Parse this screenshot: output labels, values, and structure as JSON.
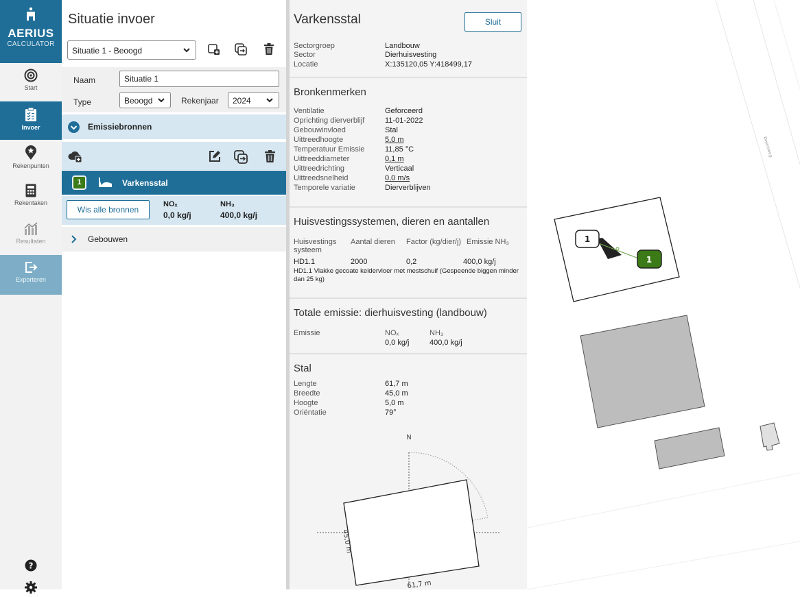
{
  "app": {
    "name": "AERIUS",
    "subtitle": "CALCULATOR"
  },
  "nav": {
    "items": [
      {
        "label": "Start"
      },
      {
        "label": "Invoer"
      },
      {
        "label": "Rekenpunten"
      },
      {
        "label": "Rekentaken"
      },
      {
        "label": "Resultaten"
      },
      {
        "label": "Exporteren"
      }
    ]
  },
  "input": {
    "title": "Situatie invoer",
    "situation_select": "Situatie 1 - Beoogd",
    "name_label": "Naam",
    "name_value": "Situatie 1",
    "type_label": "Type",
    "type_value": "Beoogd",
    "year_label": "Rekenjaar",
    "year_value": "2024",
    "emission_sources_label": "Emissiebronnen",
    "source": {
      "number": "1",
      "name": "Varkensstal"
    },
    "clear_button": "Wis alle bronnen",
    "nox_label": "NOₓ",
    "nox_value": "0,0 kg/j",
    "nh3_label": "NH₃",
    "nh3_value": "400,0 kg/j",
    "buildings_label": "Gebouwen"
  },
  "detail": {
    "title": "Varkensstal",
    "close_button": "Sluit",
    "general": [
      {
        "k": "Sectorgroep",
        "v": "Landbouw"
      },
      {
        "k": "Sector",
        "v": "Dierhuisvesting"
      },
      {
        "k": "Locatie",
        "v": "X:135120,05 Y:418499,17"
      }
    ],
    "characteristics_title": "Bronkenmerken",
    "characteristics": [
      {
        "k": "Ventilatie",
        "v": "Geforceerd"
      },
      {
        "k": "Oprichting dierverblijf",
        "v": "11-01-2022"
      },
      {
        "k": "Gebouwinvloed",
        "v": "Stal"
      },
      {
        "k": "Uittreedhoogte",
        "v": "5,0 m"
      },
      {
        "k": "Temperatuur Emissie",
        "v": "11,85 °C"
      },
      {
        "k": "Uittreeddiameter",
        "v": "0,1 m"
      },
      {
        "k": "Uittreedrichting",
        "v": "Verticaal"
      },
      {
        "k": "Uittreedsnelheid",
        "v": "0,0 m/s"
      },
      {
        "k": "Temporele variatie",
        "v": "Dierverblijven"
      }
    ],
    "housing_title": "Huisvestingssystemen, dieren en aantallen",
    "housing_headers": [
      "Huisvestings systeem",
      "Aantal dieren",
      "Factor (kg/dier/j)",
      "Emissie NH₃"
    ],
    "housing_row": {
      "code": "HD1.1",
      "animals": "2000",
      "factor": "0,2",
      "emission": "400,0 kg/j"
    },
    "housing_description": "HD1.1 Vlakke gecoate keldervloer met mestschuif (Gespeende biggen minder dan 25 kg)",
    "total_title": "Totale emissie: dierhuisvesting (landbouw)",
    "total_label": "Emissie",
    "total_nox_label": "NOₓ",
    "total_nox_value": "0,0 kg/j",
    "total_nh3_label": "NH₃",
    "total_nh3_value": "400,0 kg/j",
    "stal_title": "Stal",
    "stal": [
      {
        "k": "Lengte",
        "v": "61,7 m"
      },
      {
        "k": "Breedte",
        "v": "45,0 m"
      },
      {
        "k": "Hoogte",
        "v": "5,0 m"
      },
      {
        "k": "Oriëntatie",
        "v": "79°"
      }
    ],
    "compass_n": "N",
    "dim_width": "45,0 m",
    "dim_length": "61,7 m"
  },
  "map": {
    "street_label": "Dwarsweg",
    "label_left": "1",
    "label_right": "1"
  },
  "colors": {
    "brand": "#1f6e98",
    "light_blue": "#d6e7f1",
    "green_badge": "#3b7a16",
    "export_bg": "#7eaec7"
  }
}
